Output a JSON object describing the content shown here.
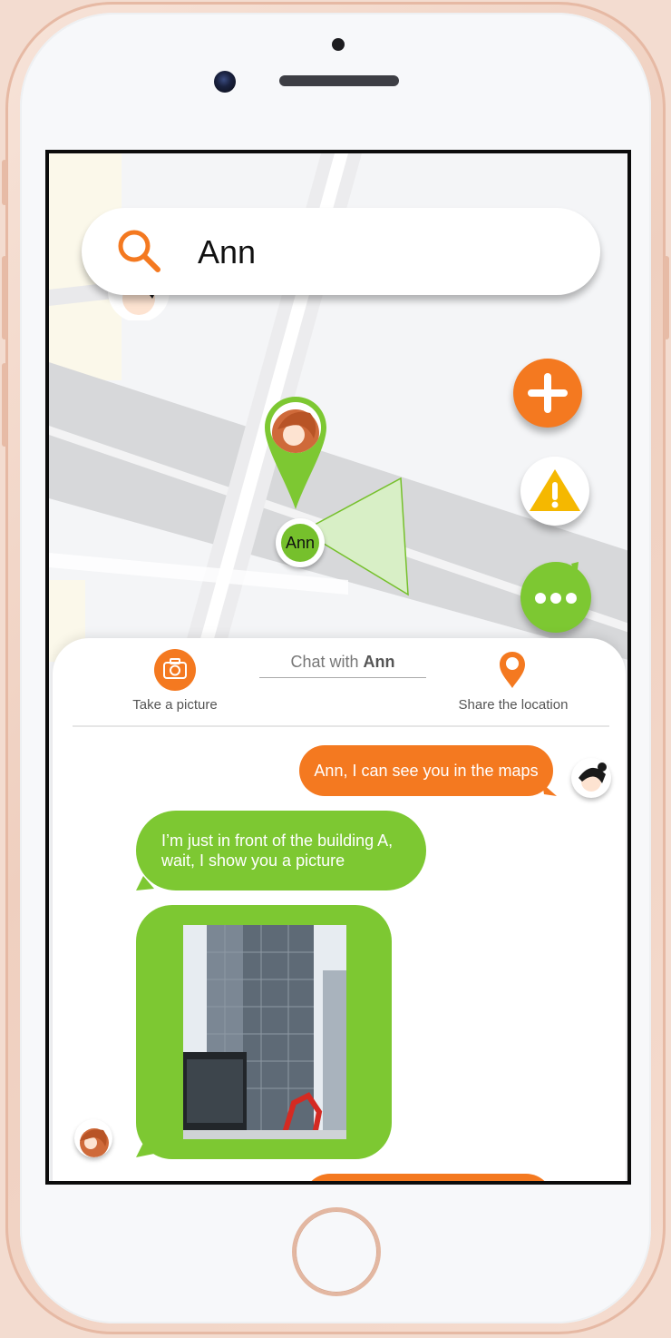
{
  "search": {
    "value": "Ann"
  },
  "map": {
    "marker_label": "Ann"
  },
  "chat": {
    "title_prefix": "Chat with ",
    "title_name": "Ann",
    "actions": {
      "take_picture": "Take a picture",
      "share_location": "Share the location"
    },
    "messages": [
      {
        "from": "me",
        "text": "Ann, I can see you in the maps"
      },
      {
        "from": "Ann",
        "text": "I’m just in front of the building A, wait, I show you a picture"
      },
      {
        "from": "Ann",
        "type": "image",
        "icon": "building-photo"
      }
    ]
  },
  "colors": {
    "orange": "#f47920",
    "green": "#7dc832",
    "warning": "#f5b800"
  },
  "icons": [
    "search-icon",
    "plus-icon",
    "warning-icon",
    "more-icon",
    "camera-icon",
    "location-pin-icon"
  ]
}
